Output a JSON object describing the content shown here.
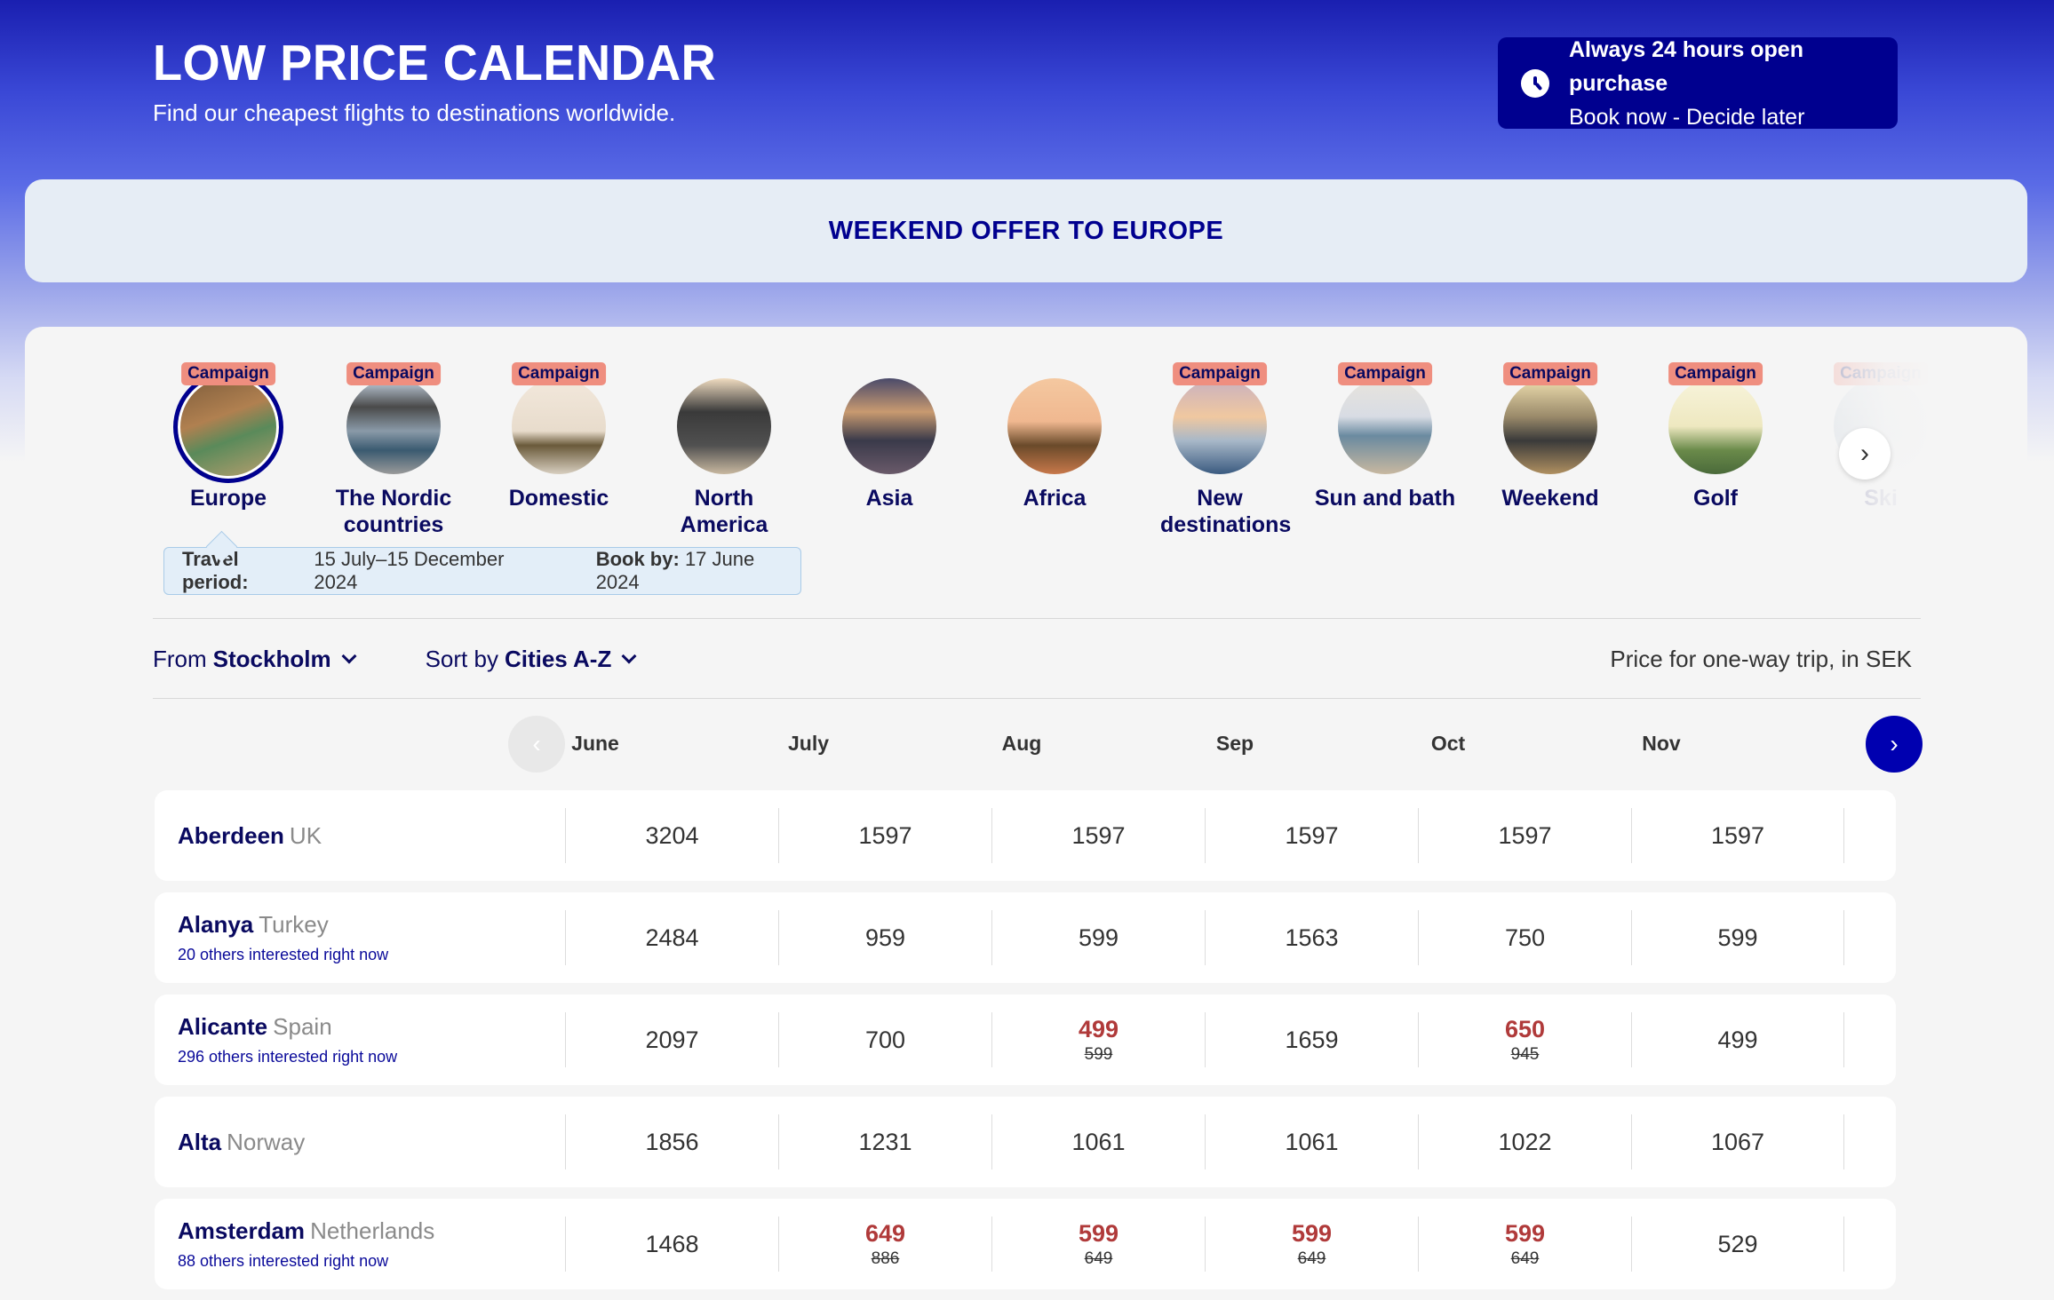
{
  "header": {
    "title": "LOW PRICE CALENDAR",
    "subtitle": "Find our cheapest flights to destinations worldwide."
  },
  "purchase_box": {
    "icon": "clock-icon",
    "title": "Always 24 hours open purchase",
    "subtitle": "Book now - Decide later"
  },
  "offer_banner": {
    "label": "WEEKEND OFFER TO EUROPE"
  },
  "categories": [
    {
      "label": "Europe",
      "badge": "Campaign",
      "selected": true,
      "thumb": "cobblestone street with scooters"
    },
    {
      "label": "The Nordic countries",
      "badge": "Campaign",
      "thumb": "mountains and fjord"
    },
    {
      "label": "Domestic",
      "badge": "Campaign",
      "thumb": "steamboat on lake"
    },
    {
      "label": "North America",
      "badge": "",
      "thumb": "city skyline"
    },
    {
      "label": "Asia",
      "badge": "",
      "thumb": "temple at dusk"
    },
    {
      "label": "Africa",
      "badge": "",
      "thumb": "giraffe at sunset"
    },
    {
      "label": "New destinations",
      "badge": "Campaign",
      "thumb": "airplane over sea"
    },
    {
      "label": "Sun and bath",
      "badge": "Campaign",
      "thumb": "beach umbrella"
    },
    {
      "label": "Weekend",
      "badge": "Campaign",
      "thumb": "promenade at sunset"
    },
    {
      "label": "Golf",
      "badge": "Campaign",
      "thumb": "golf course"
    },
    {
      "label": "Ski",
      "badge": "Campaign",
      "thumb": "snowy slope"
    }
  ],
  "period": {
    "travel_label": "Travel period:",
    "travel_value": "15 July–15 December 2024",
    "book_label": "Book by:",
    "book_value": "17 June 2024"
  },
  "filters": {
    "from_label": "From",
    "from_value": "Stockholm",
    "sort_label": "Sort by",
    "sort_value": "Cities A-Z",
    "price_note": "Price for one-way trip, in SEK"
  },
  "months": [
    "June",
    "July",
    "Aug",
    "Sep",
    "Oct",
    "Nov"
  ],
  "colors": {
    "brand_dark": "#00008f",
    "campaign_badge": "#ef8e7f",
    "sale_price": "#b03a3a"
  },
  "rows": [
    {
      "city": "Aberdeen",
      "country": "UK",
      "interest": "",
      "prices": [
        {
          "price": "3204"
        },
        {
          "price": "1597"
        },
        {
          "price": "1597"
        },
        {
          "price": "1597"
        },
        {
          "price": "1597"
        },
        {
          "price": "1597"
        }
      ]
    },
    {
      "city": "Alanya",
      "country": "Turkey",
      "interest": "20 others interested right now",
      "prices": [
        {
          "price": "2484"
        },
        {
          "price": "959"
        },
        {
          "price": "599"
        },
        {
          "price": "1563"
        },
        {
          "price": "750"
        },
        {
          "price": "599"
        }
      ]
    },
    {
      "city": "Alicante",
      "country": "Spain",
      "interest": "296 others interested right now",
      "prices": [
        {
          "price": "2097"
        },
        {
          "price": "700"
        },
        {
          "price": "499",
          "old": "599"
        },
        {
          "price": "1659"
        },
        {
          "price": "650",
          "old": "945"
        },
        {
          "price": "499"
        }
      ]
    },
    {
      "city": "Alta",
      "country": "Norway",
      "interest": "",
      "prices": [
        {
          "price": "1856"
        },
        {
          "price": "1231"
        },
        {
          "price": "1061"
        },
        {
          "price": "1061"
        },
        {
          "price": "1022"
        },
        {
          "price": "1067"
        }
      ]
    },
    {
      "city": "Amsterdam",
      "country": "Netherlands",
      "interest": "88 others interested right now",
      "prices": [
        {
          "price": "1468"
        },
        {
          "price": "649",
          "old": "886"
        },
        {
          "price": "599",
          "old": "649"
        },
        {
          "price": "599",
          "old": "649"
        },
        {
          "price": "599",
          "old": "649"
        },
        {
          "price": "529"
        }
      ]
    }
  ]
}
